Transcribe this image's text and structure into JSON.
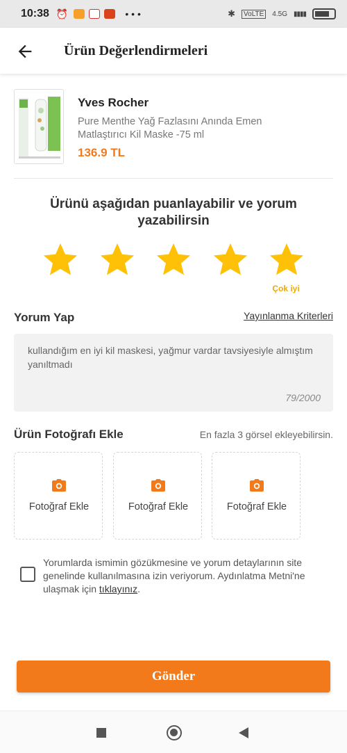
{
  "status_bar": {
    "time": "10:38",
    "dots": "• • •",
    "network": "4.5G",
    "signal": "▮▮▮▮"
  },
  "header": {
    "title": "Ürün Değerlendirmeleri",
    "back_icon": "back-arrow-icon"
  },
  "product": {
    "brand": "Yves Rocher",
    "name": "Pure Menthe Yağ Fazlasını Anında Emen Matlaştırıcı Kil Maske -75 ml",
    "price": "136.9 TL"
  },
  "rating": {
    "prompt": "Ürünü aşağıdan puanlayabilir ve yorum yazabilirsin",
    "value": 5,
    "max": 5,
    "label": "Çok iyi",
    "star_color": "#ffc107"
  },
  "review": {
    "title": "Yorum Yap",
    "criteria_link": "Yayınlanma Kriterleri",
    "text": "kullandığım en iyi kil maskesi, yağmur vardar tavsiyesiyle almıştım yanıltmadı",
    "char_count": "79/2000"
  },
  "photos": {
    "title": "Ürün Fotoğrafı Ekle",
    "hint": "En fazla 3 görsel ekleyebilirsin.",
    "add_label": "Fotoğraf Ekle",
    "slots": [
      {
        "label": "Fotoğraf Ekle"
      },
      {
        "label": "Fotoğraf Ekle"
      },
      {
        "label": "Fotoğraf Ekle"
      }
    ]
  },
  "consent": {
    "checked": false,
    "text": "Yorumlarda ismimin gözükmesine ve yorum detaylarının site genelinde kullanılmasına izin veriyorum. Aydınlatma Metni'ne ulaşmak için ",
    "link_text": "tıklayınız",
    "suffix": "."
  },
  "submit": {
    "label": "Gönder"
  },
  "colors": {
    "accent": "#f27a1a",
    "star": "#ffc107",
    "rating_label": "#f2a900"
  }
}
